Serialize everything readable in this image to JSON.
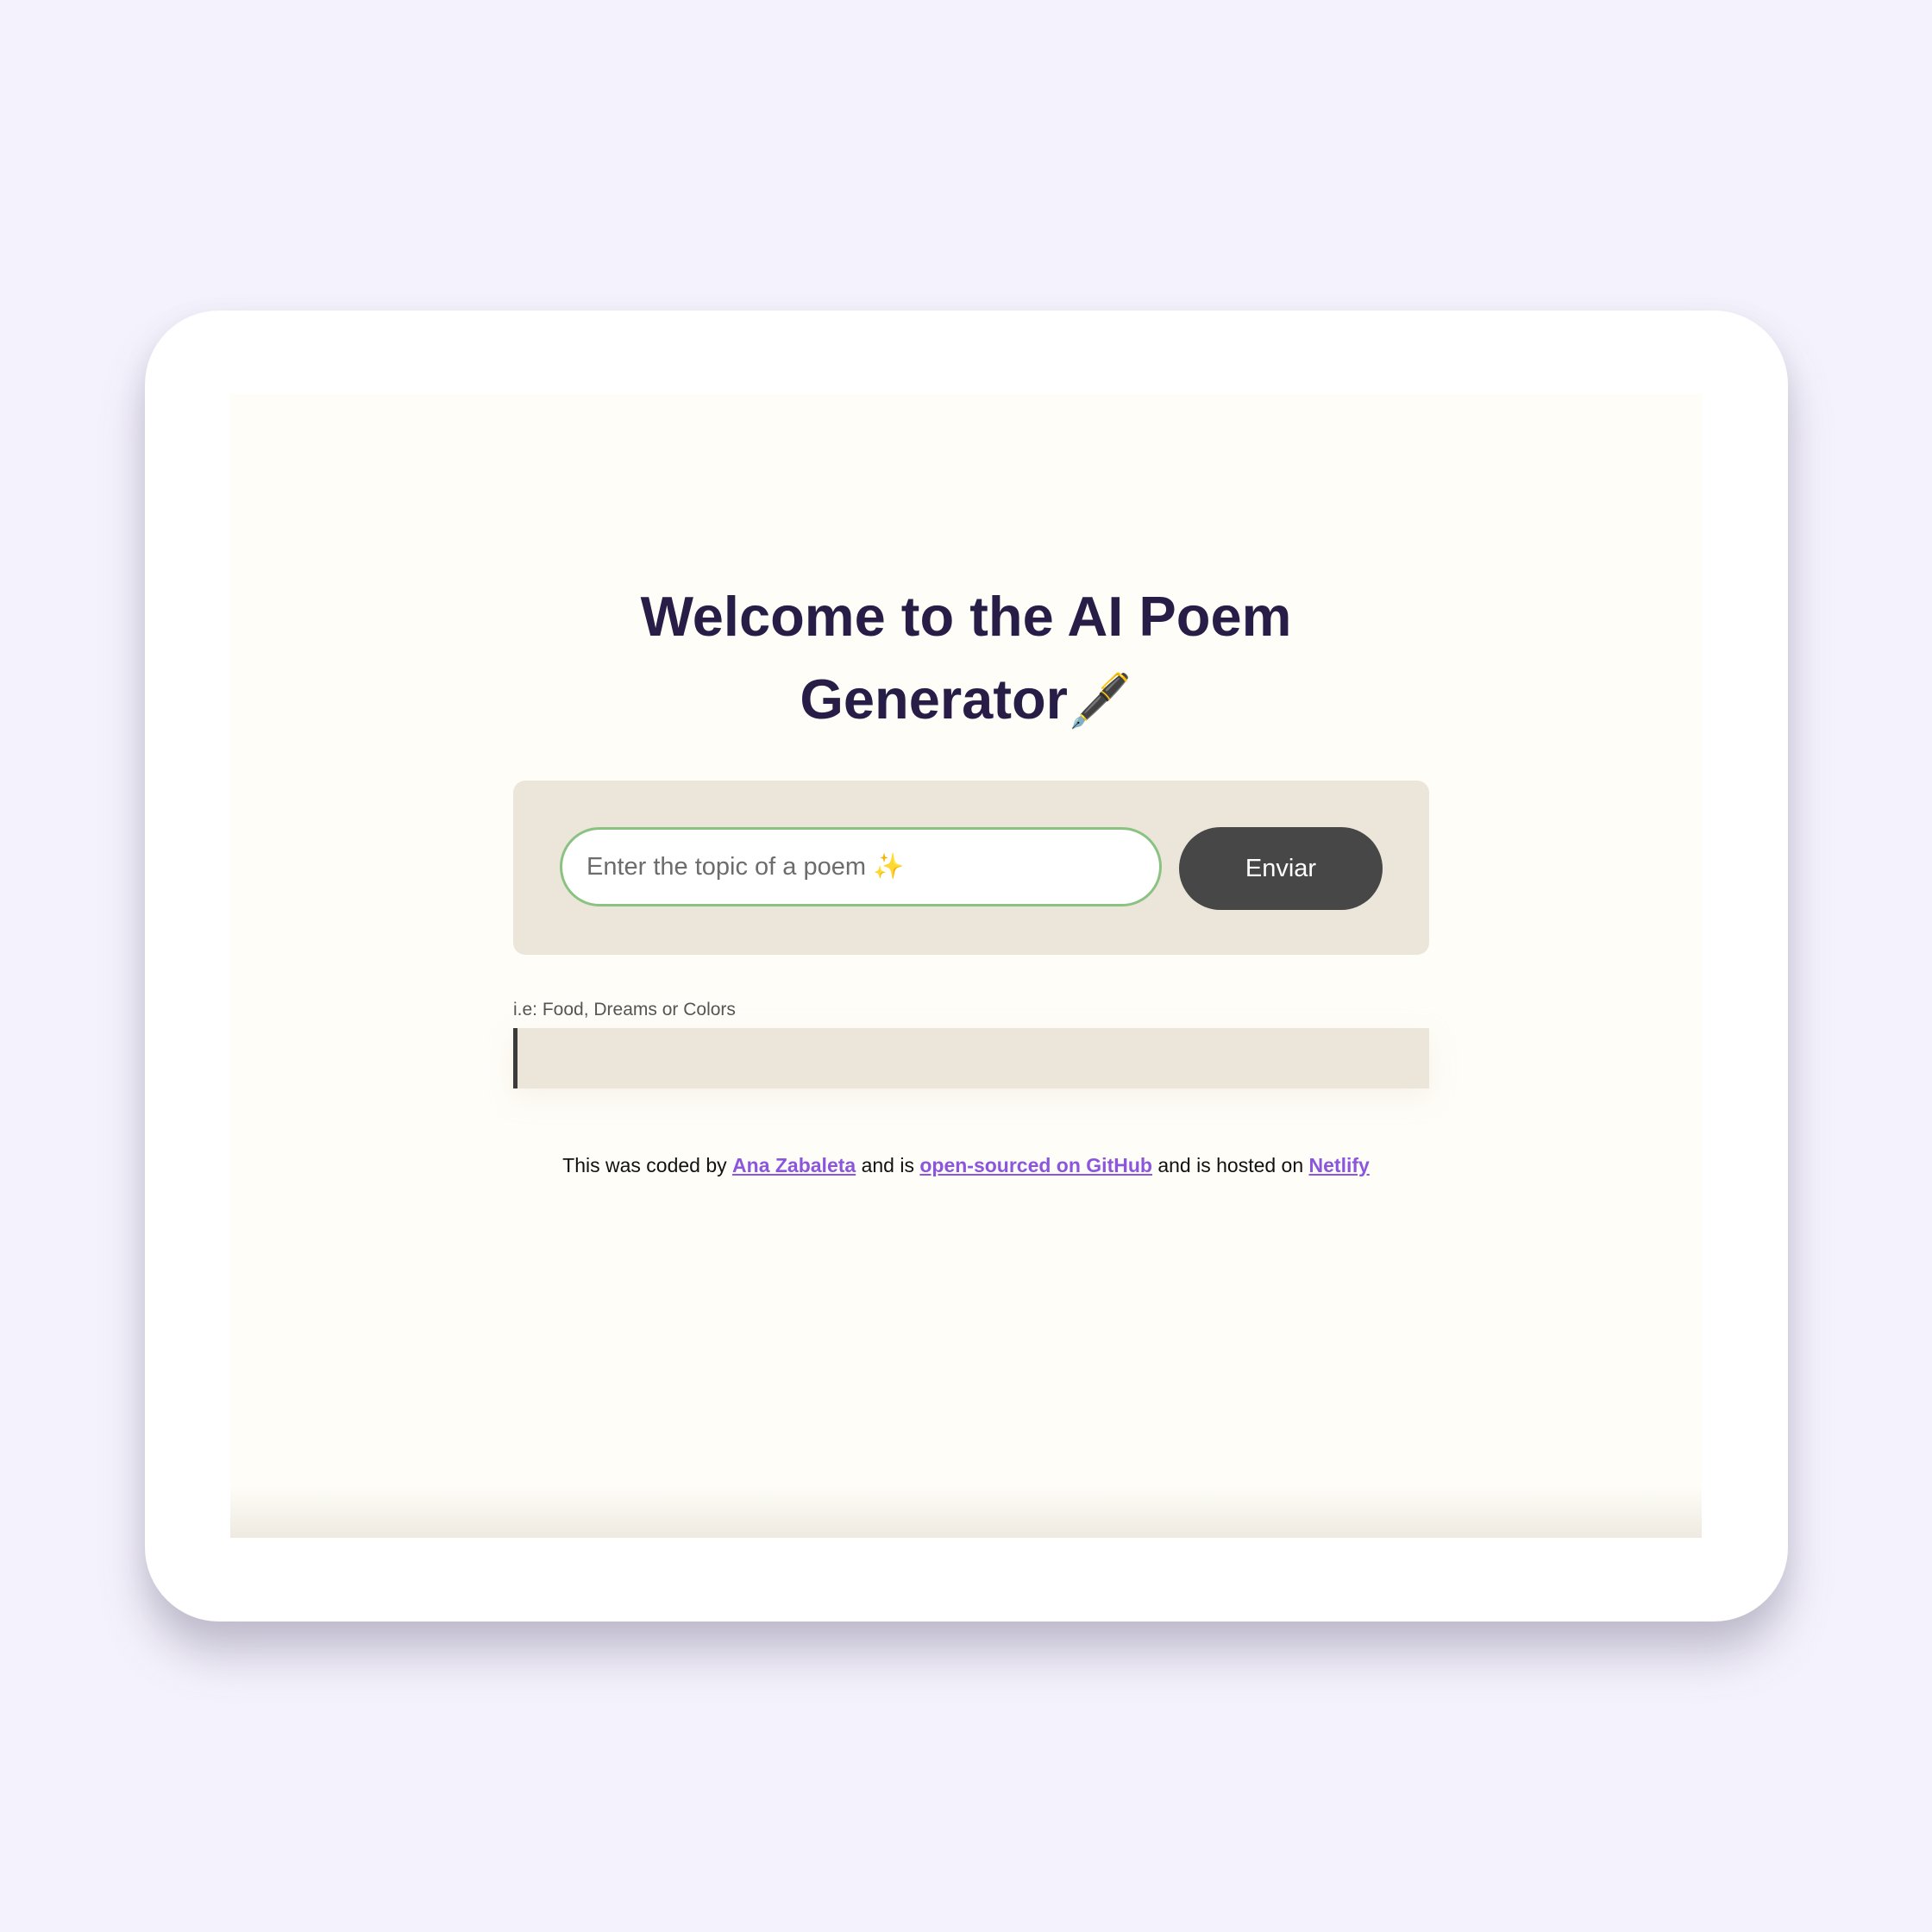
{
  "app": {
    "title_line1": "Welcome to the AI Poem",
    "title_line2": "Generator",
    "title_emoji": "🖋️"
  },
  "form": {
    "input_value": "",
    "input_placeholder": "Enter the topic of a poem ✨",
    "submit_label": "Enviar"
  },
  "hint": "i.e: Food, Dreams or Colors",
  "poem": {
    "text": ""
  },
  "footer": {
    "prefix": "This was coded by ",
    "author_link": "Ana Zabaleta",
    "middle1": " and is ",
    "github_link": "open-sourced on GitHub",
    "middle2": " and is hosted on ",
    "netlify_link": "Netlify"
  },
  "colors": {
    "page_background": "#f4f2fc",
    "screen_background": "#fffdf8",
    "panel_background": "#ebe6d9",
    "title_color": "#271d46",
    "input_border": "#8ac282",
    "button_background": "#474747",
    "link_color": "#8c55de"
  }
}
